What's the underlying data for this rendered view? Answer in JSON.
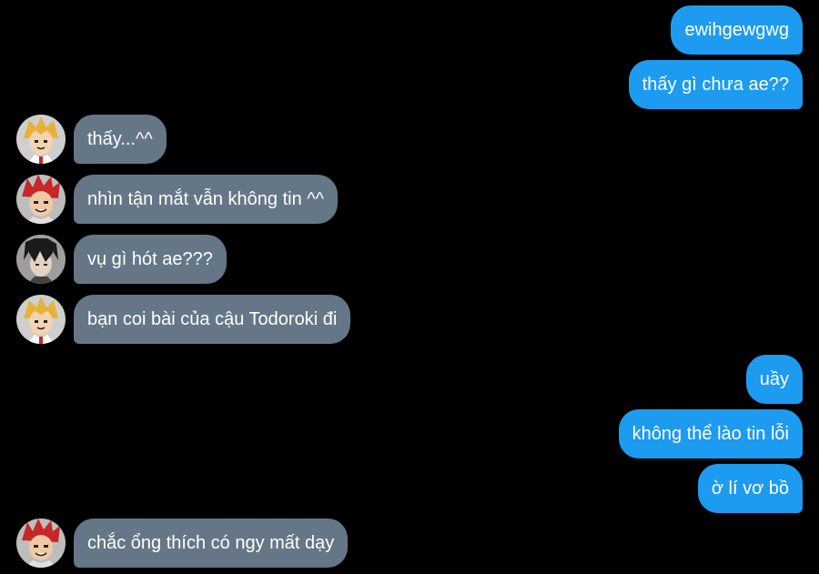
{
  "messages": [
    {
      "text": "ewihgewgwg",
      "side": "out"
    },
    {
      "text": "thấy gì chưa ae??",
      "side": "out"
    },
    {
      "text": "thấy...^^",
      "side": "in",
      "avatar": "avatar-blonde-boy"
    },
    {
      "text": "nhìn tận mắt vẫn không tin ^^",
      "side": "in",
      "avatar": "avatar-red-hair-boy"
    },
    {
      "text": "vụ gì hót ae???",
      "side": "in",
      "avatar": "avatar-dark-hair-boy"
    },
    {
      "text": "bạn coi bài của cậu Todoroki đi",
      "side": "in",
      "avatar": "avatar-blonde-boy"
    },
    {
      "text": "uầy",
      "side": "out"
    },
    {
      "text": "không thể lào tin lỗi",
      "side": "out"
    },
    {
      "text": "ờ lí vơ bồ",
      "side": "out"
    },
    {
      "text": "chắc ổng thích có ngy mất dạy",
      "side": "in",
      "avatar": "avatar-red-hair-boy"
    }
  ],
  "colors": {
    "background": "#000000",
    "outgoing_bubble": "#1d9bf0",
    "incoming_bubble": "#657786",
    "text": "#ffffff"
  }
}
